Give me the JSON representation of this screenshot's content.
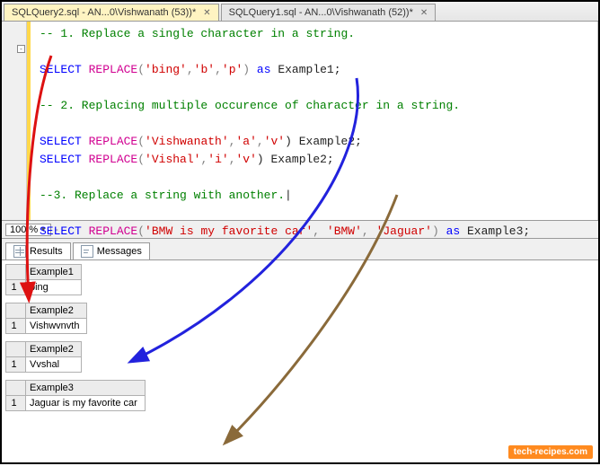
{
  "tabs": [
    {
      "label": "SQLQuery2.sql - AN...0\\Vishwanath (53))*",
      "active": true
    },
    {
      "label": "SQLQuery1.sql - AN...0\\Vishwanath (52))*",
      "active": false
    }
  ],
  "code": {
    "c1": "-- 1. Replace a single character in a string.",
    "kw_select": "SELECT",
    "fn_replace": "REPLACE",
    "l1a": "(",
    "s1_1": "'bing'",
    "comma": ",",
    "s1_2": "'b'",
    "s1_3": "'p'",
    "l1b": ") ",
    "kw_as": "as",
    "ex1": " Example1;",
    "c2": "-- 2. Replacing multiple occurence of character in a string.",
    "s2_1": "'Vishwanath'",
    "s2_2": "'a'",
    "s2_3": "'v'",
    "ex2a": ") Example2;",
    "s3_1": "'Vishal'",
    "s3_2": "'i'",
    "s3_3": "'v'",
    "ex2b": ") Example2;",
    "c3": "--3. Replace a string with another.",
    "s4_1": "'BMW is my favorite car'",
    "s4_2": "'BMW'",
    "s4_3": "'Jaguar'",
    "ex3": " Example3;"
  },
  "zoom": "100 %",
  "zoom_dash": "-",
  "result_tabs": {
    "results": "Results",
    "messages": "Messages"
  },
  "grids": [
    {
      "header": "Example1",
      "rownum": "1",
      "value": "ping"
    },
    {
      "header": "Example2",
      "rownum": "1",
      "value": "Vishwvnvth"
    },
    {
      "header": "Example2",
      "rownum": "1",
      "value": "Vvshal"
    },
    {
      "header": "Example3",
      "rownum": "1",
      "value": "Jaguar is my favorite car"
    }
  ],
  "watermark": "tech-recipes.com"
}
